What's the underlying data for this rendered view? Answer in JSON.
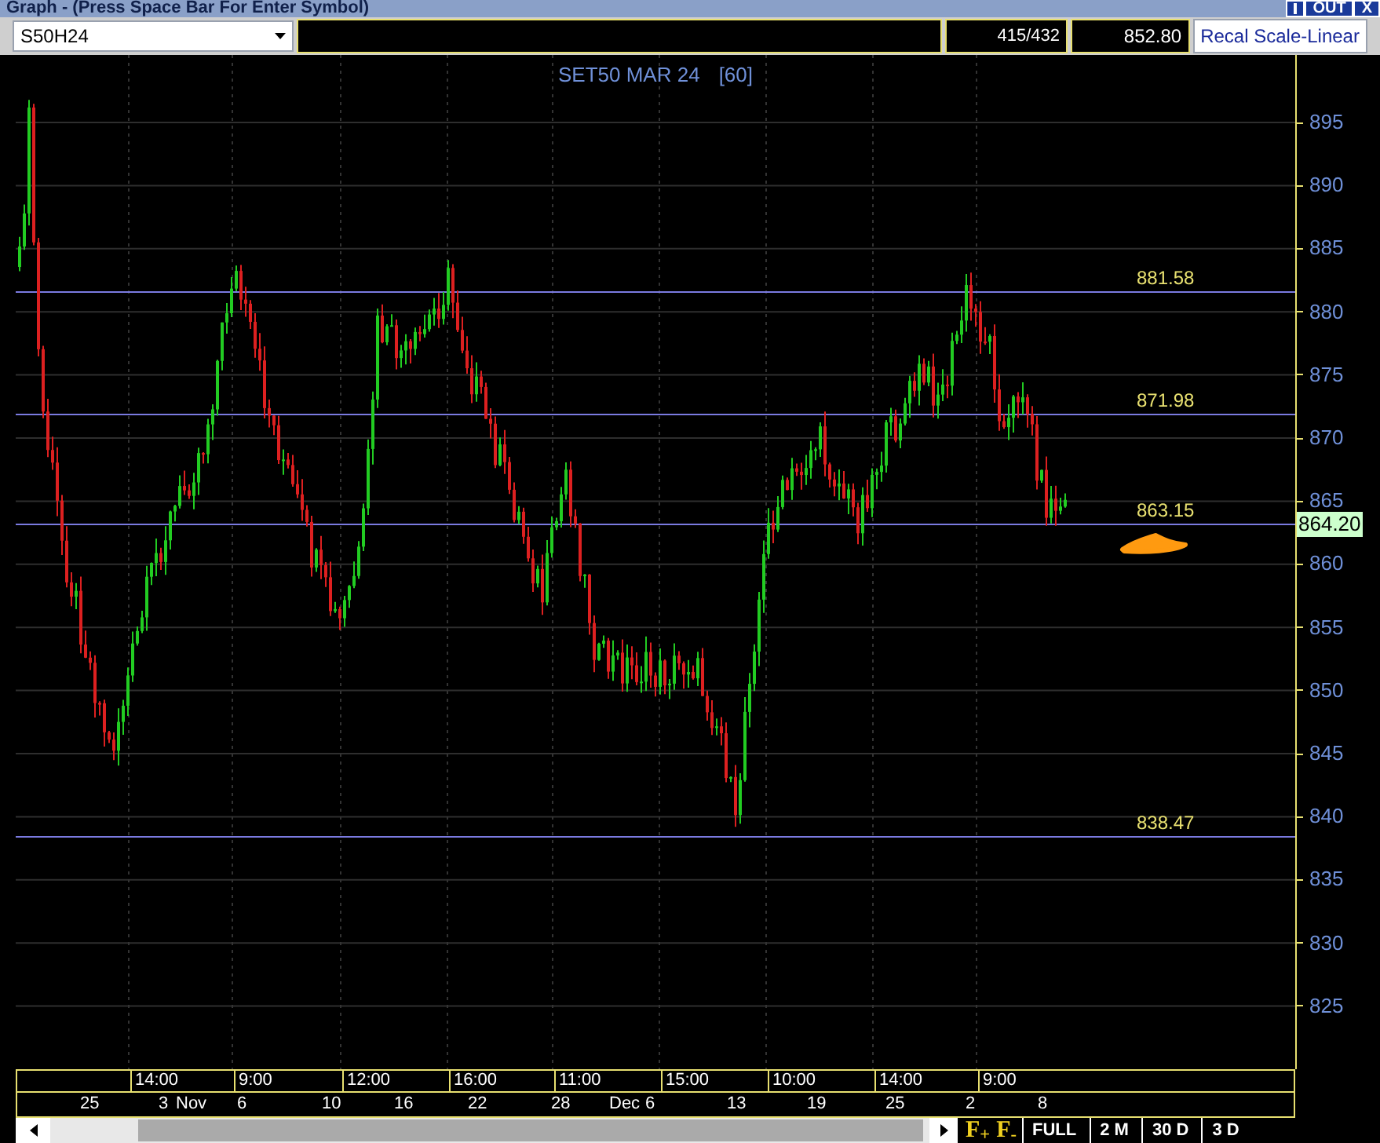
{
  "window": {
    "title": "Graph  - (Press Space Bar For Enter Symbol)",
    "buttons": [
      "OUT",
      "X"
    ]
  },
  "toolbar": {
    "symbol": "S50H24",
    "count": "415/432",
    "price": "852.80",
    "scale_button": "Recal Scale-Linear"
  },
  "chart": {
    "title": "SET50 MAR 24",
    "interval": "[60]",
    "y_labels": [
      "895",
      "890",
      "885",
      "880",
      "875",
      "870",
      "865",
      "860",
      "855",
      "850",
      "845",
      "840",
      "835",
      "830",
      "825"
    ],
    "levels": [
      {
        "label": "881.58"
      },
      {
        "label": "871.98"
      },
      {
        "label": "863.15"
      },
      {
        "label": "838.47"
      }
    ],
    "last_price": "864.20",
    "time_labels": [
      "14:00",
      "9:00",
      "12:00",
      "16:00",
      "11:00",
      "15:00",
      "10:00",
      "14:00",
      "9:00"
    ],
    "date_labels": [
      "25",
      "3",
      "Nov",
      "6",
      "10",
      "16",
      "22",
      "28",
      "Dec",
      "6",
      "13",
      "19",
      "25",
      "2",
      "8"
    ]
  },
  "range_buttons": [
    "F$_{+}$",
    "F$_{-}$",
    "FULL",
    "2 M",
    "30 D",
    "3 D"
  ]
}
